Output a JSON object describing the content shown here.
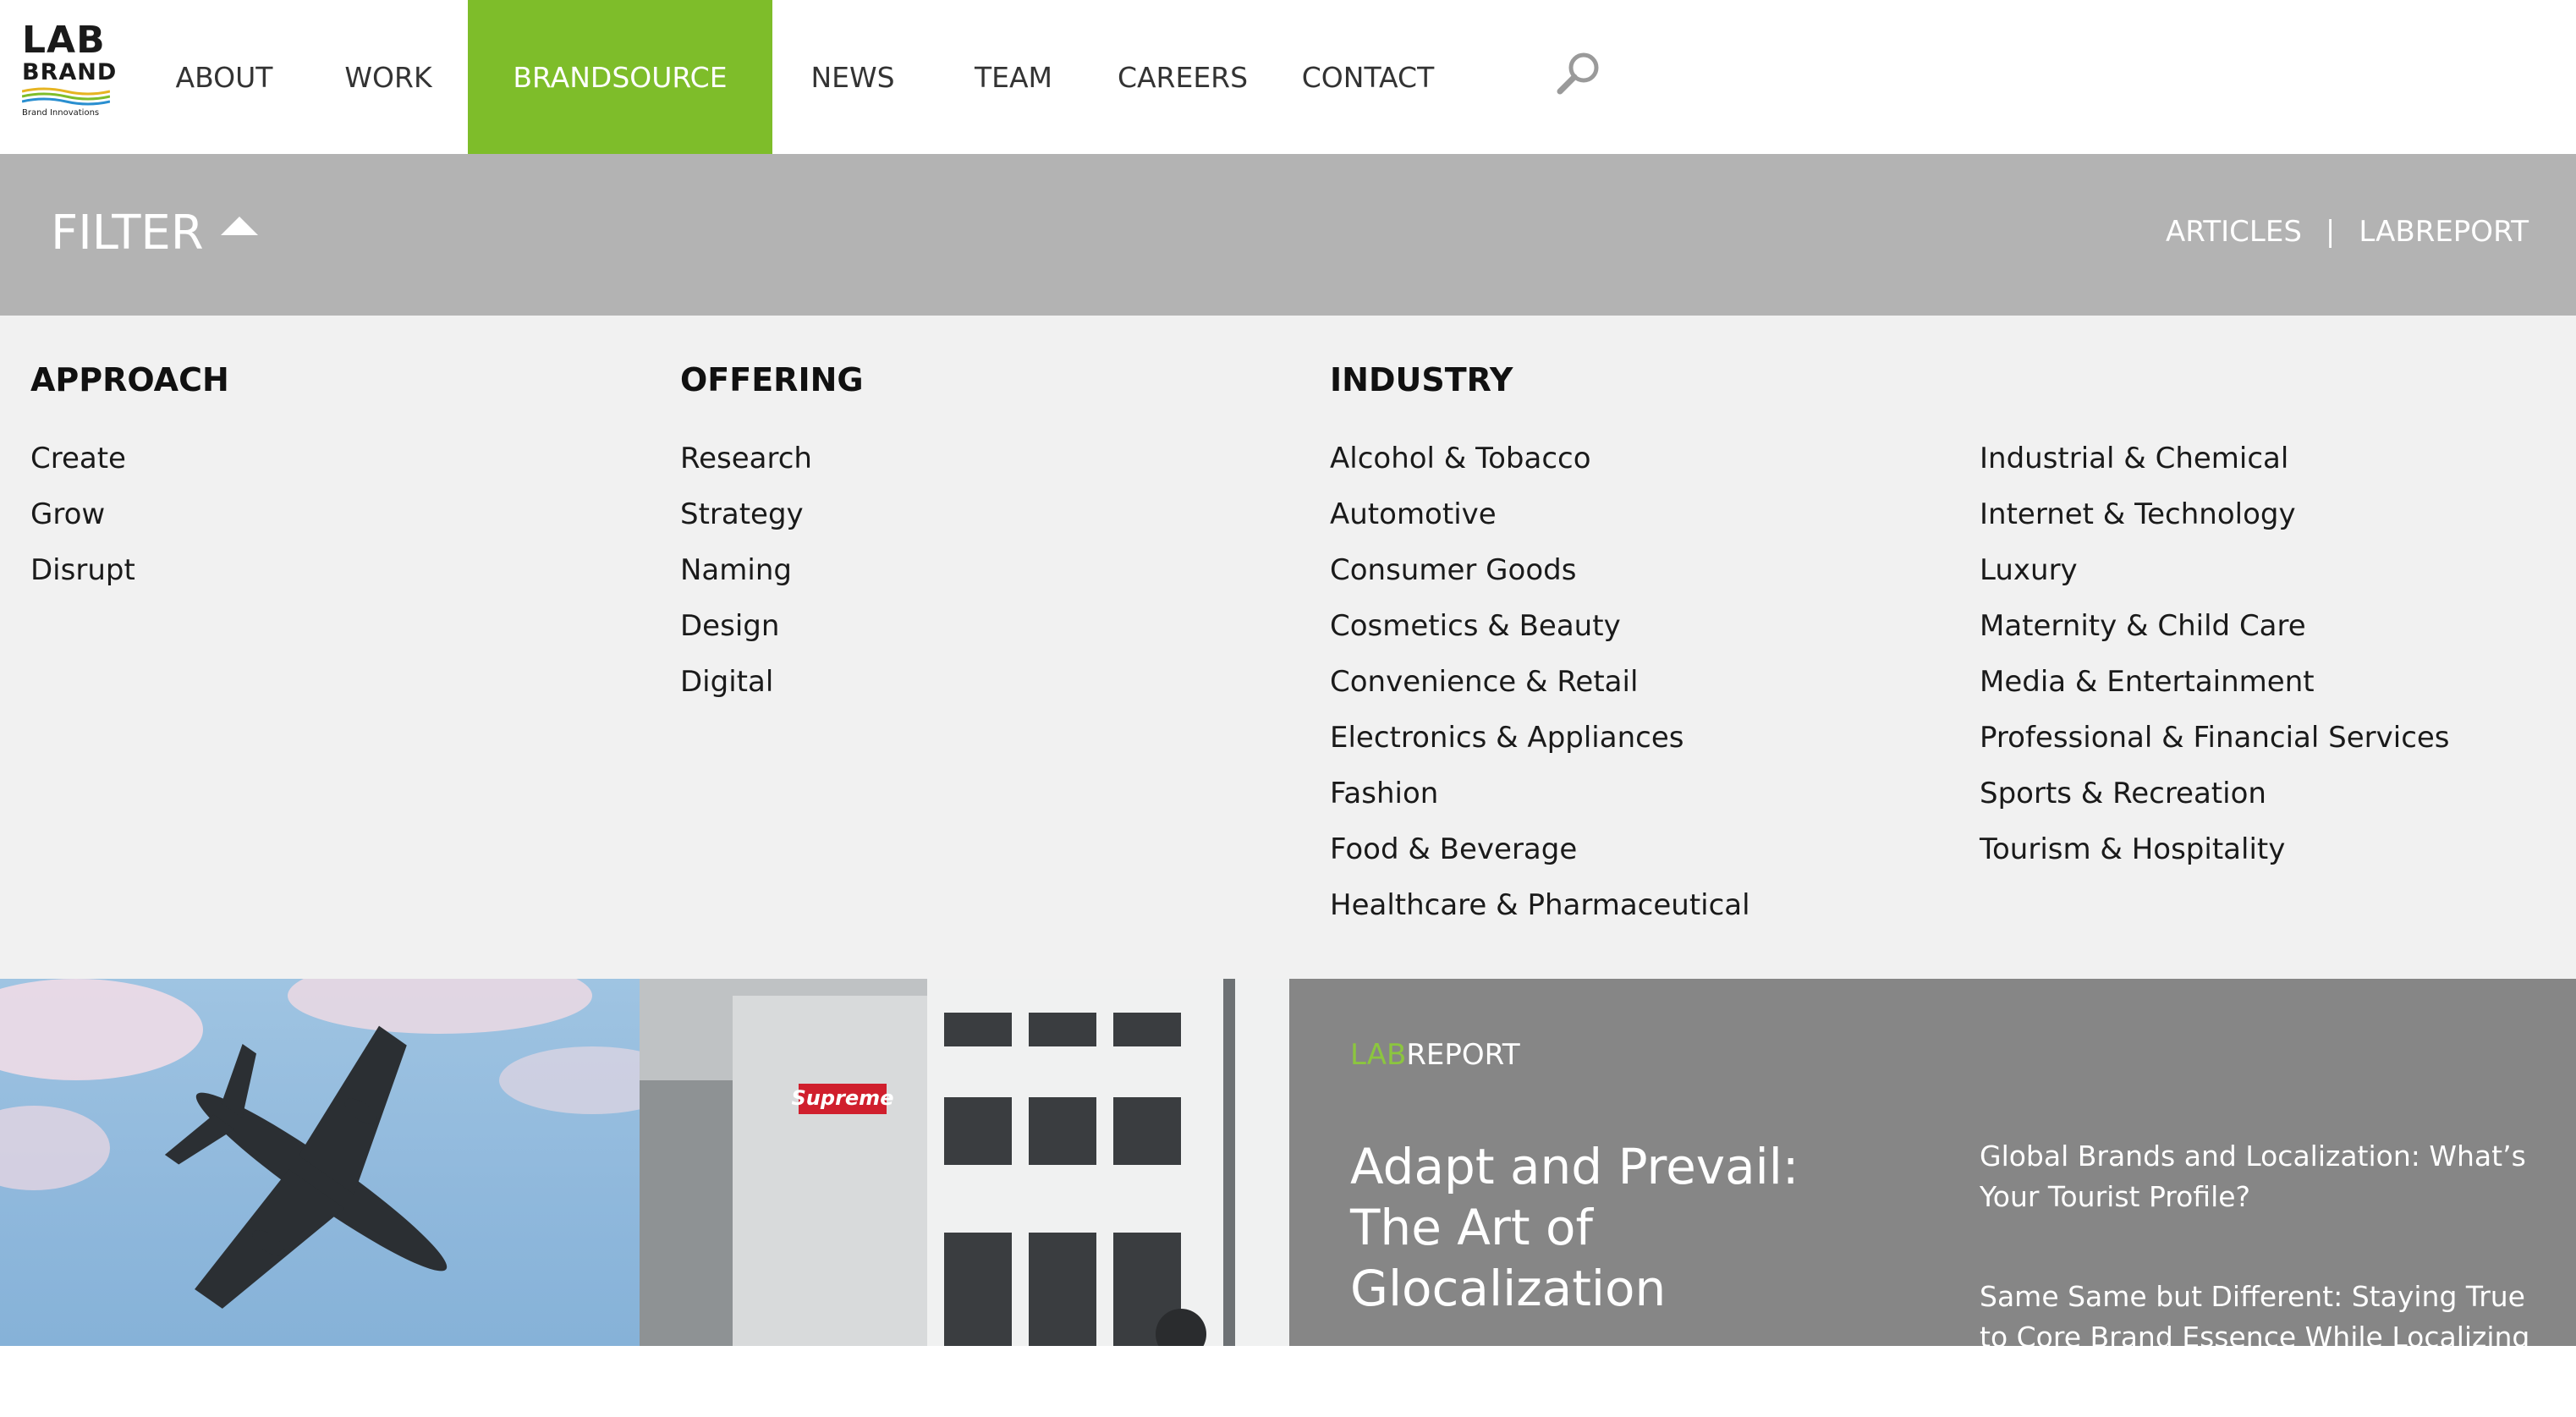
{
  "logo": {
    "line1": "LAB",
    "line2": "BRAND",
    "tagline": "Brand Innovations"
  },
  "nav": {
    "items": [
      {
        "label": "ABOUT"
      },
      {
        "label": "WORK"
      },
      {
        "label": "BRANDSOURCE",
        "active": true
      },
      {
        "label": "NEWS"
      },
      {
        "label": "TEAM"
      },
      {
        "label": "CAREERS"
      },
      {
        "label": "CONTACT"
      }
    ],
    "search_icon": "search-icon"
  },
  "filter": {
    "label": "FILTER",
    "links": {
      "articles": "ARTICLES",
      "separator": "|",
      "labreport": "LABREPORT"
    }
  },
  "panel": {
    "approach": {
      "heading": "APPROACH",
      "items": [
        "Create",
        "Grow",
        "Disrupt"
      ]
    },
    "offering": {
      "heading": "OFFERING",
      "items": [
        "Research",
        "Strategy",
        "Naming",
        "Design",
        "Digital"
      ]
    },
    "industry": {
      "heading": "INDUSTRY",
      "items_left": [
        "Alcohol & Tobacco",
        "Automotive",
        "Consumer Goods",
        "Cosmetics & Beauty",
        "Convenience & Retail",
        "Electronics & Appliances",
        "Fashion",
        "Food & Beverage",
        "Healthcare & Pharmaceutical"
      ],
      "items_right": [
        "Industrial & Chemical",
        "Internet & Technology",
        "Luxury",
        "Maternity & Child Care",
        "Media & Entertainment",
        "Professional & Financial Services",
        "Sports & Recreation",
        "Tourism & Hospitality"
      ]
    }
  },
  "bottom": {
    "street_sign": "Supreme",
    "report": {
      "tag_lab": "LAB",
      "tag_report": "REPORT",
      "main_title": "Adapt and Prevail: The Art of Glocalization",
      "side_items": [
        "Global Brands and Localization: What’s Your Tourist Profile?",
        "Same Same but Different: Staying True to Core Brand Essence While Localizing"
      ]
    }
  },
  "colors": {
    "accent": "#7ebd2a",
    "filter_bar": "#b3b3b3",
    "panel_bg": "#f1f1f1",
    "report_bg": "#868686",
    "lab_green": "#8cc63f"
  }
}
